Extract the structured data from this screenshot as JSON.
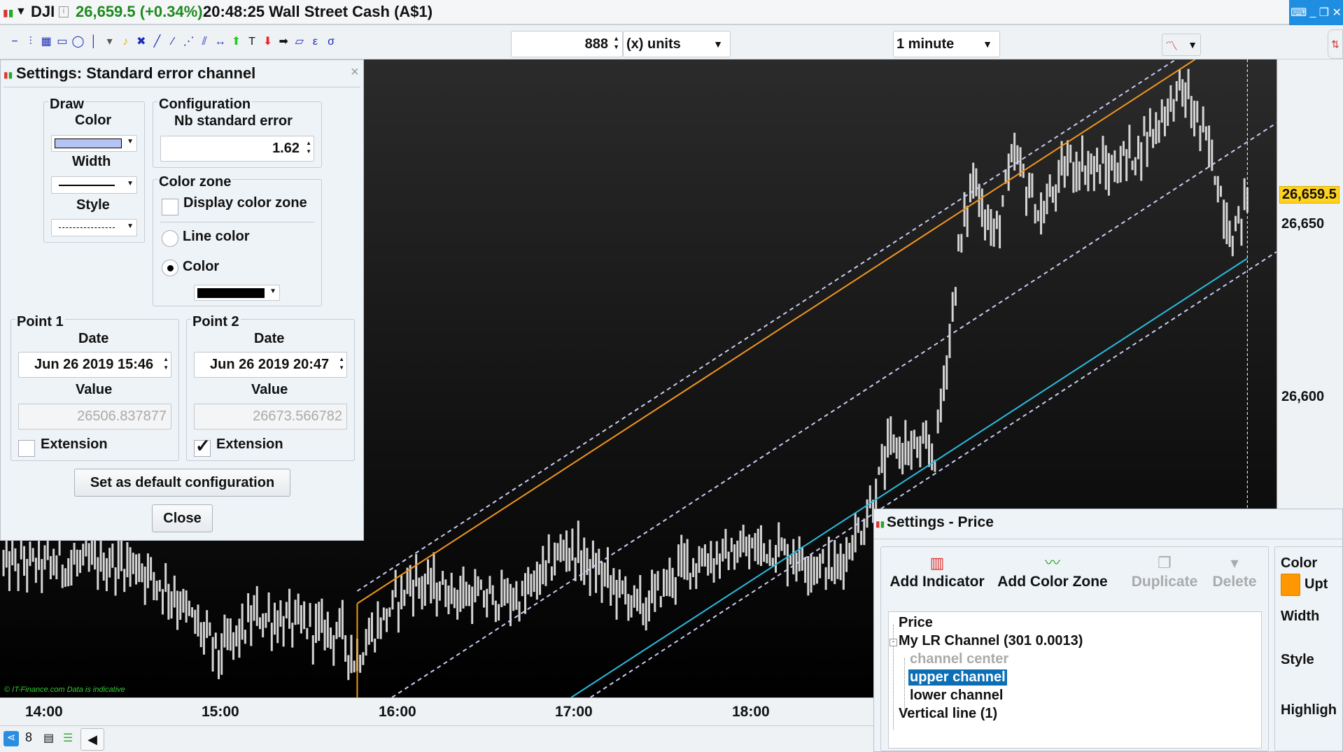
{
  "titlebar": {
    "symbol": "DJI",
    "price_change": "26,659.5 (+0.34%)",
    "time_name": "20:48:25 Wall Street Cash (A$1)",
    "price_color": "#1e8a1e"
  },
  "toolbar": {
    "tools": [
      "horizontal-line",
      "vertical-range",
      "indicator-draw",
      "rectangle",
      "ellipse",
      "vertical-line",
      "trash",
      "alert-bell",
      "tools-settings",
      "trend-line",
      "segment",
      "dotted-segment",
      "parallel-lines",
      "horizontal-segment",
      "buy-arrow",
      "text-note",
      "sell-arrow",
      "right-arrow",
      "ruler",
      "epsilon-channel",
      "sigma-channel"
    ],
    "units_value": "888",
    "units_label": "(x) units",
    "period_label": "1 minute"
  },
  "chart": {
    "watermark": "© IT-Finance.com  Data is indicative",
    "current_price_label": "26,659.5",
    "y_ticks": [
      "26,650",
      "26,600"
    ],
    "x_ticks": [
      "14:00",
      "15:00",
      "16:00",
      "17:00",
      "18:00"
    ]
  },
  "chart_data": {
    "type": "ohlc",
    "x_unit": "minutes since 14:00",
    "y_unit": "price",
    "price_anchors": [
      [
        -14,
        26552
      ],
      [
        31,
        26552
      ],
      [
        43,
        26544
      ],
      [
        59,
        26526
      ],
      [
        72,
        26537
      ],
      [
        101,
        26532
      ],
      [
        105,
        26524
      ],
      [
        124,
        26547
      ],
      [
        147,
        26542
      ],
      [
        162,
        26542
      ],
      [
        177,
        26557
      ],
      [
        203,
        26539
      ],
      [
        217,
        26552
      ],
      [
        246,
        26557
      ],
      [
        268,
        26550
      ],
      [
        278,
        26564
      ],
      [
        287,
        26586
      ],
      [
        302,
        26584
      ],
      [
        306,
        26611
      ],
      [
        310,
        26641
      ],
      [
        315,
        26664
      ],
      [
        322,
        26646
      ],
      [
        329,
        26670
      ],
      [
        338,
        26652
      ],
      [
        347,
        26668
      ],
      [
        362,
        26666
      ],
      [
        371,
        26672
      ],
      [
        386,
        26690
      ],
      [
        395,
        26672
      ],
      [
        403,
        26646
      ],
      [
        408,
        26658
      ]
    ],
    "current_price": 26659.5,
    "std_error_channel": {
      "point1": [
        106,
        26506.837877
      ],
      "point2": [
        407,
        26673.566782
      ],
      "offset": 37.3,
      "color": "#c7cdf2"
    },
    "lr_channel": {
      "offset": 33.7,
      "upper_color": "#f0961e",
      "lower_color": "#28bde0",
      "end": 408
    },
    "cursor_minute": 408
  },
  "settings_dialog": {
    "title": "Settings: Standard error channel",
    "close_x": "×",
    "draw": {
      "legend": "Draw",
      "color_label": "Color",
      "width_label": "Width",
      "style_label": "Style",
      "color": "#b3c4f5"
    },
    "configuration": {
      "legend": "Configuration",
      "nb_label": "Nb standard error",
      "nb_value": "1.62"
    },
    "color_zone": {
      "legend": "Color zone",
      "display_label": "Display color zone",
      "line_color_label": "Line color",
      "color_label": "Color",
      "color": "#000000"
    },
    "point1": {
      "legend": "Point 1",
      "date_label": "Date",
      "date": "Jun 26 2019 15:46",
      "value_label": "Value",
      "value": "26506.837877",
      "extension_label": "Extension"
    },
    "point2": {
      "legend": "Point 2",
      "date_label": "Date",
      "date": "Jun 26 2019 20:47",
      "value_label": "Value",
      "value": "26673.566782",
      "extension_label": "Extension"
    },
    "default_button": "Set as default configuration",
    "close_button": "Close"
  },
  "price_settings": {
    "title": "Settings - Price",
    "actions": [
      "Add Indicator",
      "Add Color Zone",
      "Duplicate",
      "Delete"
    ],
    "tree": [
      "Price",
      "My LR Channel (301 0.0013)",
      "channel center",
      "upper channel",
      "lower channel",
      "Vertical line (1)"
    ],
    "props": {
      "color_label": "Color",
      "color_value": "Upt",
      "width_label": "Width",
      "style_label": "Style",
      "highlight_label": "Highligh",
      "color": "#ff9800"
    }
  }
}
